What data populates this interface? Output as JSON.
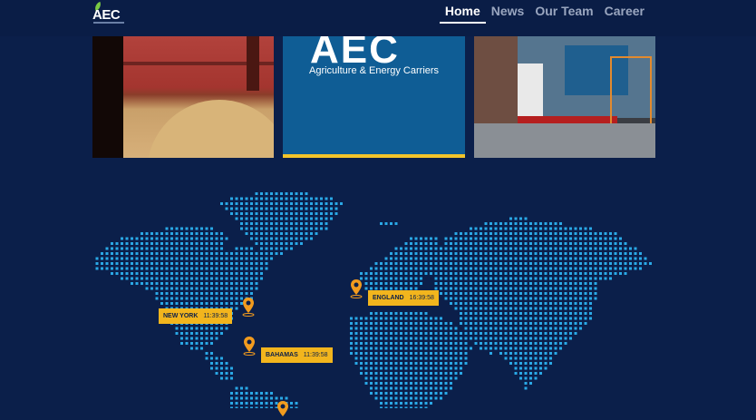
{
  "nav": {
    "brand": "AEC",
    "links": [
      "Home",
      "News",
      "Our Team",
      "Career"
    ]
  },
  "hero": {
    "brand_title": "AEC",
    "brand_subtitle": "Agriculture & Energy Carriers"
  },
  "map": {
    "locations": [
      {
        "name": "NEW YORK",
        "time": "11:39:58"
      },
      {
        "name": "BAHAMAS",
        "time": "11:39:58"
      },
      {
        "name": "ENGLAND",
        "time": "16:39:58"
      }
    ]
  },
  "colors": {
    "background": "#0b1f4a",
    "dot": "#2aa8e6",
    "label_bg": "#f2b51d",
    "pin": "#f29b1e"
  }
}
